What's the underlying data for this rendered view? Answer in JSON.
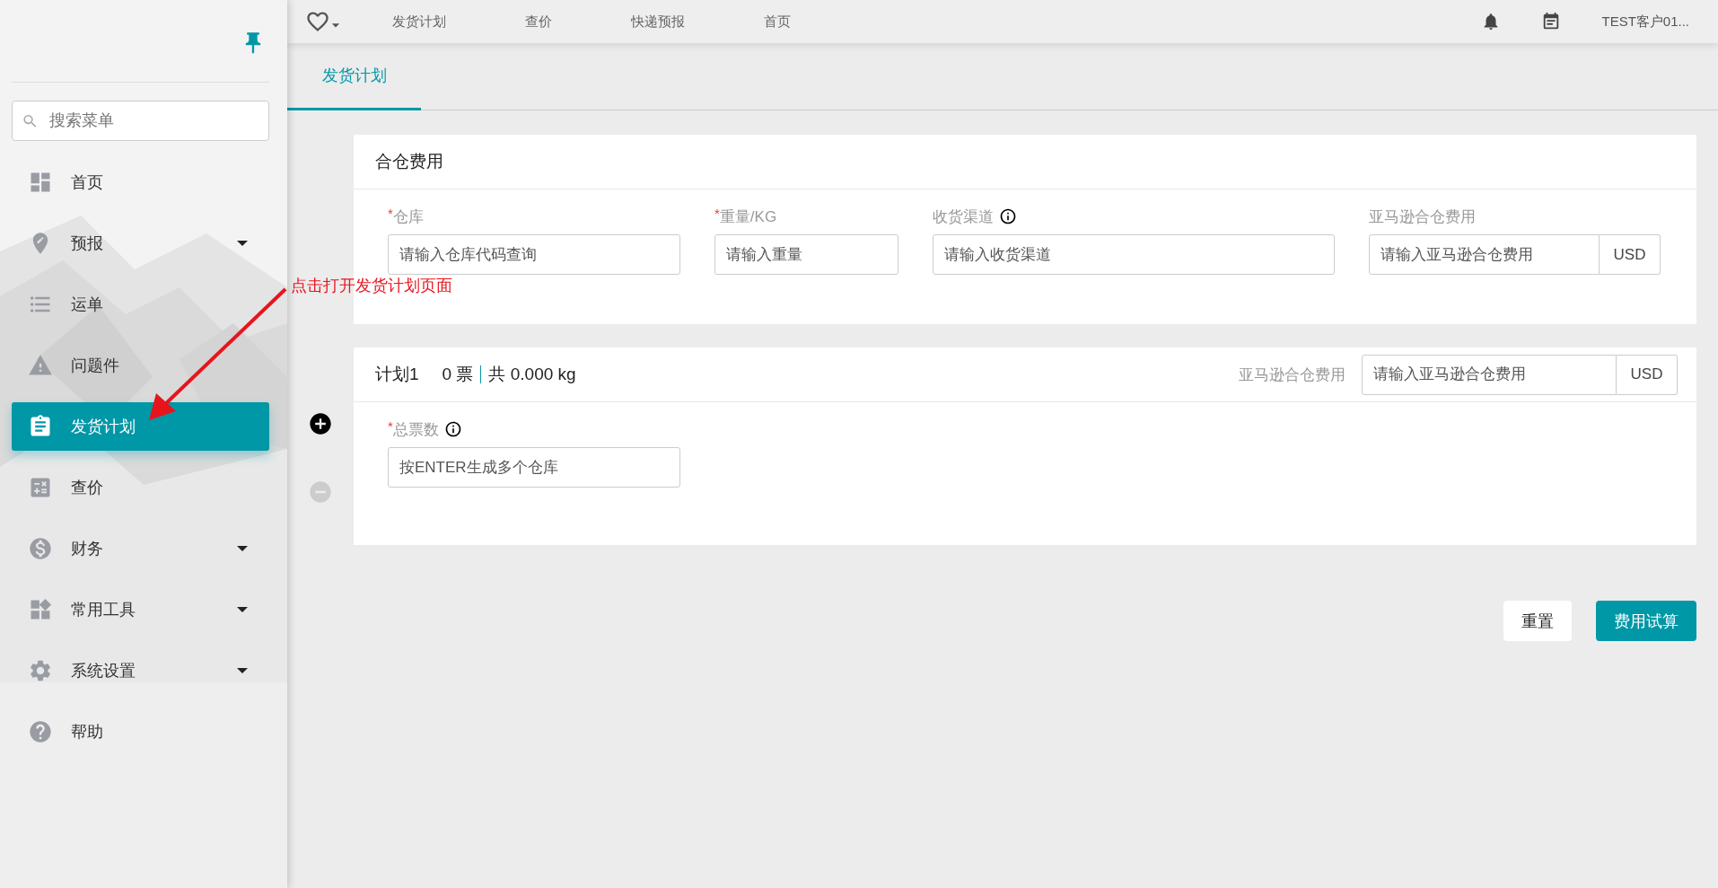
{
  "topbar": {
    "nav_items": [
      {
        "label": "发货计划"
      },
      {
        "label": "查价"
      },
      {
        "label": "快递预报"
      },
      {
        "label": "首页"
      }
    ],
    "user": "TEST客户01..."
  },
  "sidebar": {
    "search": {
      "placeholder": "搜索菜单"
    },
    "items": [
      {
        "label": "首页",
        "expandable": false,
        "selected": false
      },
      {
        "label": "预报",
        "expandable": true,
        "selected": false
      },
      {
        "label": "运单",
        "expandable": false,
        "selected": false
      },
      {
        "label": "问题件",
        "expandable": false,
        "selected": false
      },
      {
        "label": "发货计划",
        "expandable": false,
        "selected": true
      },
      {
        "label": "查价",
        "expandable": false,
        "selected": false
      },
      {
        "label": "财务",
        "expandable": true,
        "selected": false
      },
      {
        "label": "常用工具",
        "expandable": true,
        "selected": false
      },
      {
        "label": "系统设置",
        "expandable": true,
        "selected": false
      },
      {
        "label": "帮助",
        "expandable": false,
        "selected": false
      }
    ]
  },
  "tabs": [
    {
      "label": "发货计划",
      "selected": true
    }
  ],
  "fee_card": {
    "title": "合仓费用",
    "fields": [
      {
        "mark": "*",
        "label": "仓库",
        "info": false,
        "placeholder": "请输入仓库代码查询"
      },
      {
        "mark": "*",
        "label": "重量/KG",
        "info": false,
        "placeholder": "请输入重量"
      },
      {
        "label": "收货渠道",
        "info": true,
        "placeholder": "请输入收货渠道"
      },
      {
        "label": "亚马逊合仓费用",
        "info": false,
        "placeholder": "请输入亚马逊合仓费用",
        "suffix": "USD"
      }
    ]
  },
  "plans": [
    {
      "title": "计划1",
      "tickets": "0 票",
      "total": "共 0.000 kg",
      "fee_label": "亚马逊合仓费用",
      "fee_placeholder": "请输入亚马逊合仓费用",
      "fee_suffix": "USD",
      "fields": [
        {
          "mark": "*",
          "label": "总票数",
          "info": true,
          "placeholder": "按ENTER生成多个仓库"
        }
      ]
    }
  ],
  "plan_controls": {
    "add_disabled": false,
    "remove_disabled": true
  },
  "buttons": [
    {
      "label": "重置",
      "kind": "secondary"
    },
    {
      "label": "费用试算",
      "kind": "primary"
    }
  ],
  "annotation": "点击打开发货计划页面"
}
